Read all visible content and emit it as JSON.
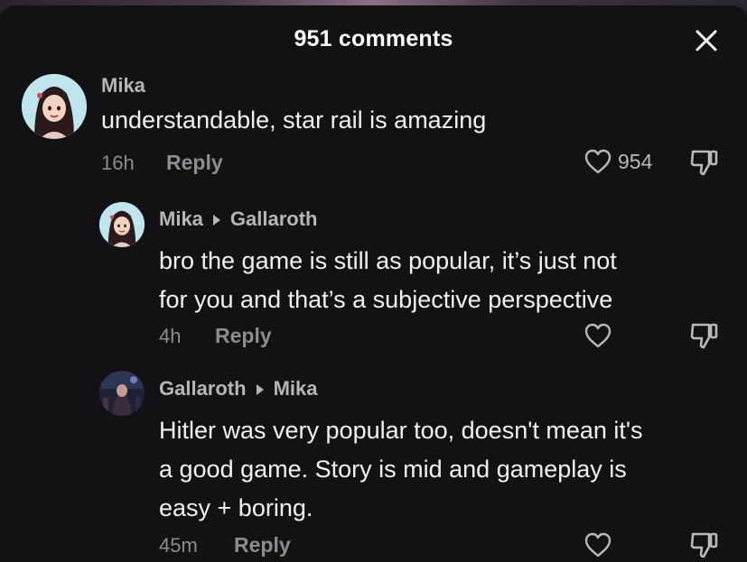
{
  "header": {
    "title": "951 comments",
    "close_icon": "close-icon"
  },
  "comments": [
    {
      "username": "Mika",
      "text": "understandable, star rail is amazing",
      "time": "16h",
      "reply_label": "Reply",
      "like_count": "954"
    },
    {
      "username": "Mika",
      "reply_to": "Gallaroth",
      "text_lines": [
        "bro the game is still as popular, it’s just not",
        "for you and that’s a subjective perspective"
      ],
      "time": "4h",
      "reply_label": "Reply"
    },
    {
      "username": "Gallaroth",
      "reply_to": "Mika",
      "text_lines": [
        "Hitler was very popular too, doesn't mean it's",
        "a good game. Story is mid and gameplay is",
        "easy + boring."
      ],
      "time": "45m",
      "reply_label": "Reply"
    }
  ],
  "colors": {
    "background": "#121214",
    "username": "#b6b6b9",
    "body_text": "#f1f1f2",
    "meta": "#8d8d91"
  }
}
